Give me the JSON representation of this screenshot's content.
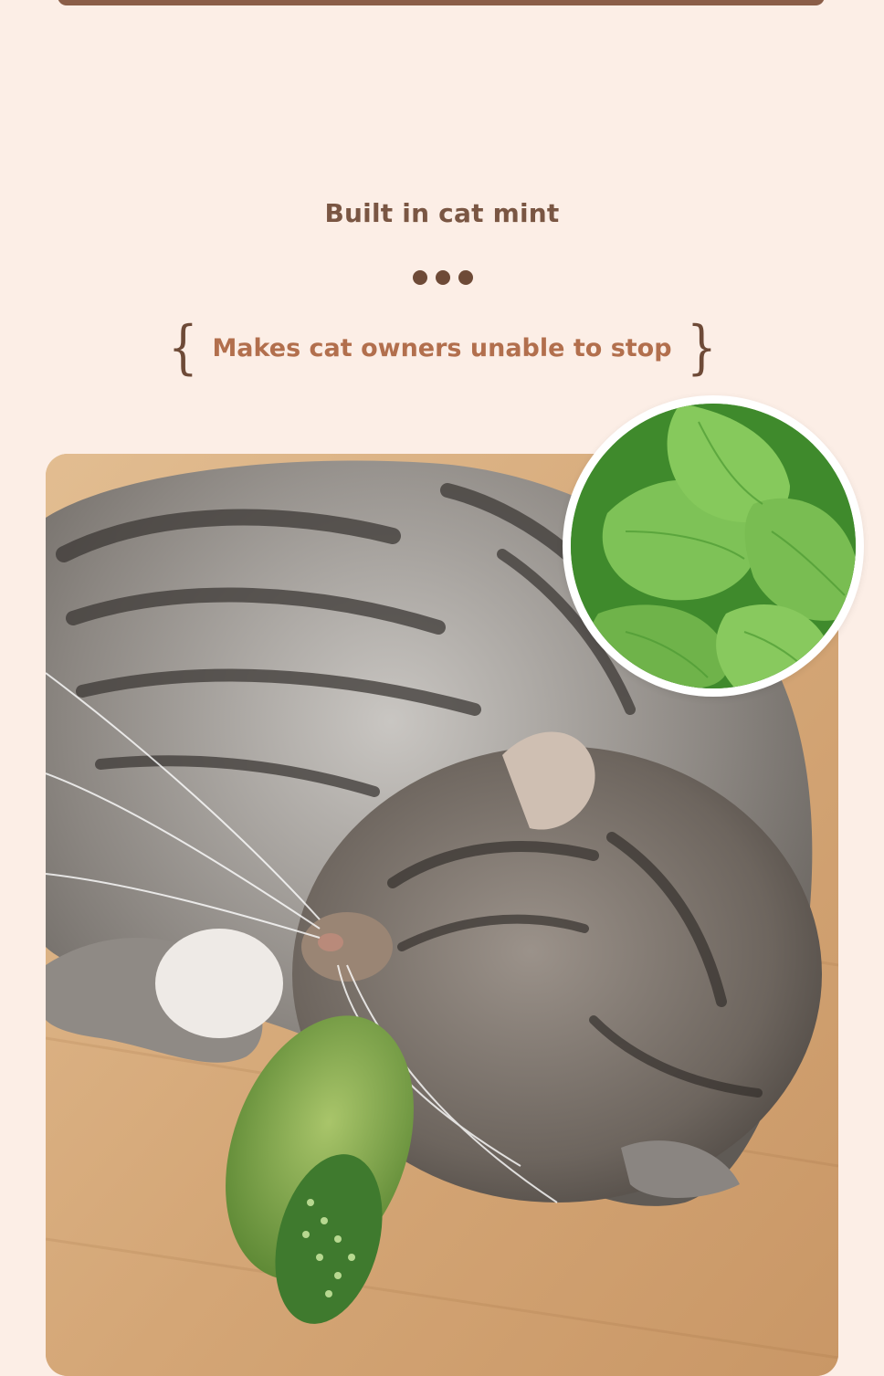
{
  "heading": "Built in cat mint",
  "tagline": {
    "open_brace": "{",
    "text": "Makes cat owners unable to stop",
    "close_brace": "}"
  },
  "colors": {
    "background": "#fceee6",
    "heading": "#7a5643",
    "tagline": "#b26f4d",
    "brace": "#6e4a37"
  },
  "images": {
    "main_photo": "tabby cat lying on wooden floor with green feather toy",
    "inset_photo": "catnip mint leaves"
  }
}
